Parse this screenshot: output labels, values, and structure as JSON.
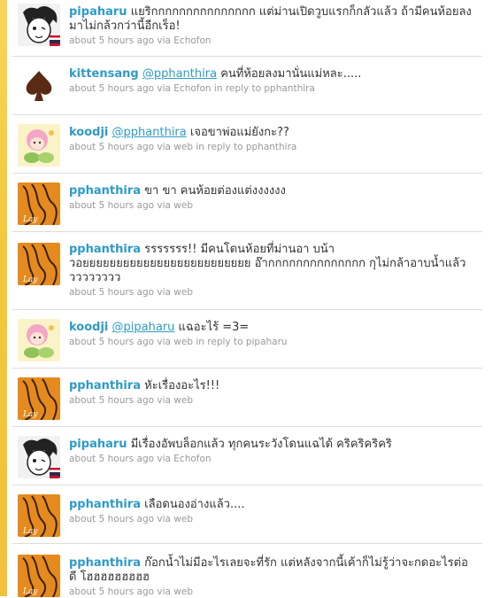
{
  "colors": {
    "link": "#2f9ac6",
    "meta": "#999999",
    "sidebar_yellow": "#f3c93b",
    "orange_avatar": "#e48a1e"
  },
  "tweets": [
    {
      "user": "pipaharu",
      "avatar": "pipaharu-avatar",
      "mention": "",
      "text": "แยริกกกกกกกกกกกกกกก แต่ม่านเปิดวูบแรกก็กลัวแล้ว ถ้ามีคนห้อยลงมาไม่กล้วกว่านี้อีกเร็อ!",
      "time": "about 5 hours ago",
      "via": "via Echofon",
      "reply": ""
    },
    {
      "user": "kittensang",
      "avatar": "spade-avatar",
      "mention": "@pphanthira",
      "text": "คนที่ห้อยลงมานั่นแม่หละ.....",
      "time": "about 5 hours ago",
      "via": "via Echofon",
      "reply": "in reply to pphanthira"
    },
    {
      "user": "koodji",
      "avatar": "koodji-avatar",
      "mention": "@pphanthira",
      "text": "เจอขาพ่อแม่ยังกะ??",
      "time": "about 5 hours ago",
      "via": "via web",
      "reply": "in reply to pphanthira"
    },
    {
      "user": "pphanthira",
      "avatar": "lay-avatar",
      "mention": "",
      "text": "ขา ขา คนห้อยต่องแต่งงงงงง",
      "time": "about 5 hours ago",
      "via": "via web",
      "reply": ""
    },
    {
      "user": "pphanthira",
      "avatar": "lay-avatar",
      "mention": "",
      "text": "รรรรรรร!! มีคนโดนห้อยที่ม่านอา บน้าวอยยยยยยยยยยยยยยยยยยยยยยยยย อ๊ากกกกกกกกกกกกกก กุไม่กล้าอาบน้ำแล้ววววววววว",
      "time": "about 5 hours ago",
      "via": "via web",
      "reply": ""
    },
    {
      "user": "koodji",
      "avatar": "koodji-avatar",
      "mention": "@pipaharu",
      "text": "แฉอะไร้ =3=",
      "time": "about 5 hours ago",
      "via": "via web",
      "reply": "in reply to pipaharu"
    },
    {
      "user": "pphanthira",
      "avatar": "lay-avatar",
      "mention": "",
      "text": "หัะเรื่องอะไร!!!",
      "time": "about 5 hours ago",
      "via": "via web",
      "reply": ""
    },
    {
      "user": "pipaharu",
      "avatar": "pipaharu-avatar",
      "mention": "",
      "text": "มีเรื่องอัพบล็อกแล้ว ทุกคนระวังโดนแฉได้ คริคริคริคริ",
      "time": "about 5 hours ago",
      "via": "via Echofon",
      "reply": ""
    },
    {
      "user": "pphanthira",
      "avatar": "lay-avatar",
      "mention": "",
      "text": "เลือดนองอ่างแล้ว....",
      "time": "about 5 hours ago",
      "via": "via web",
      "reply": ""
    },
    {
      "user": "pphanthira",
      "avatar": "lay-avatar",
      "mention": "",
      "text": "ก๊อกน้ำไม่มีอะไรเลยจะที่รัก แต่หลังจากนี้เค้าก็ไม่รู้ว่าจะกดอะไรต่อดี โฮฮฮฮฮฮฮฮฮ",
      "time": "about 5 hours ago",
      "via": "via web",
      "reply": ""
    }
  ]
}
